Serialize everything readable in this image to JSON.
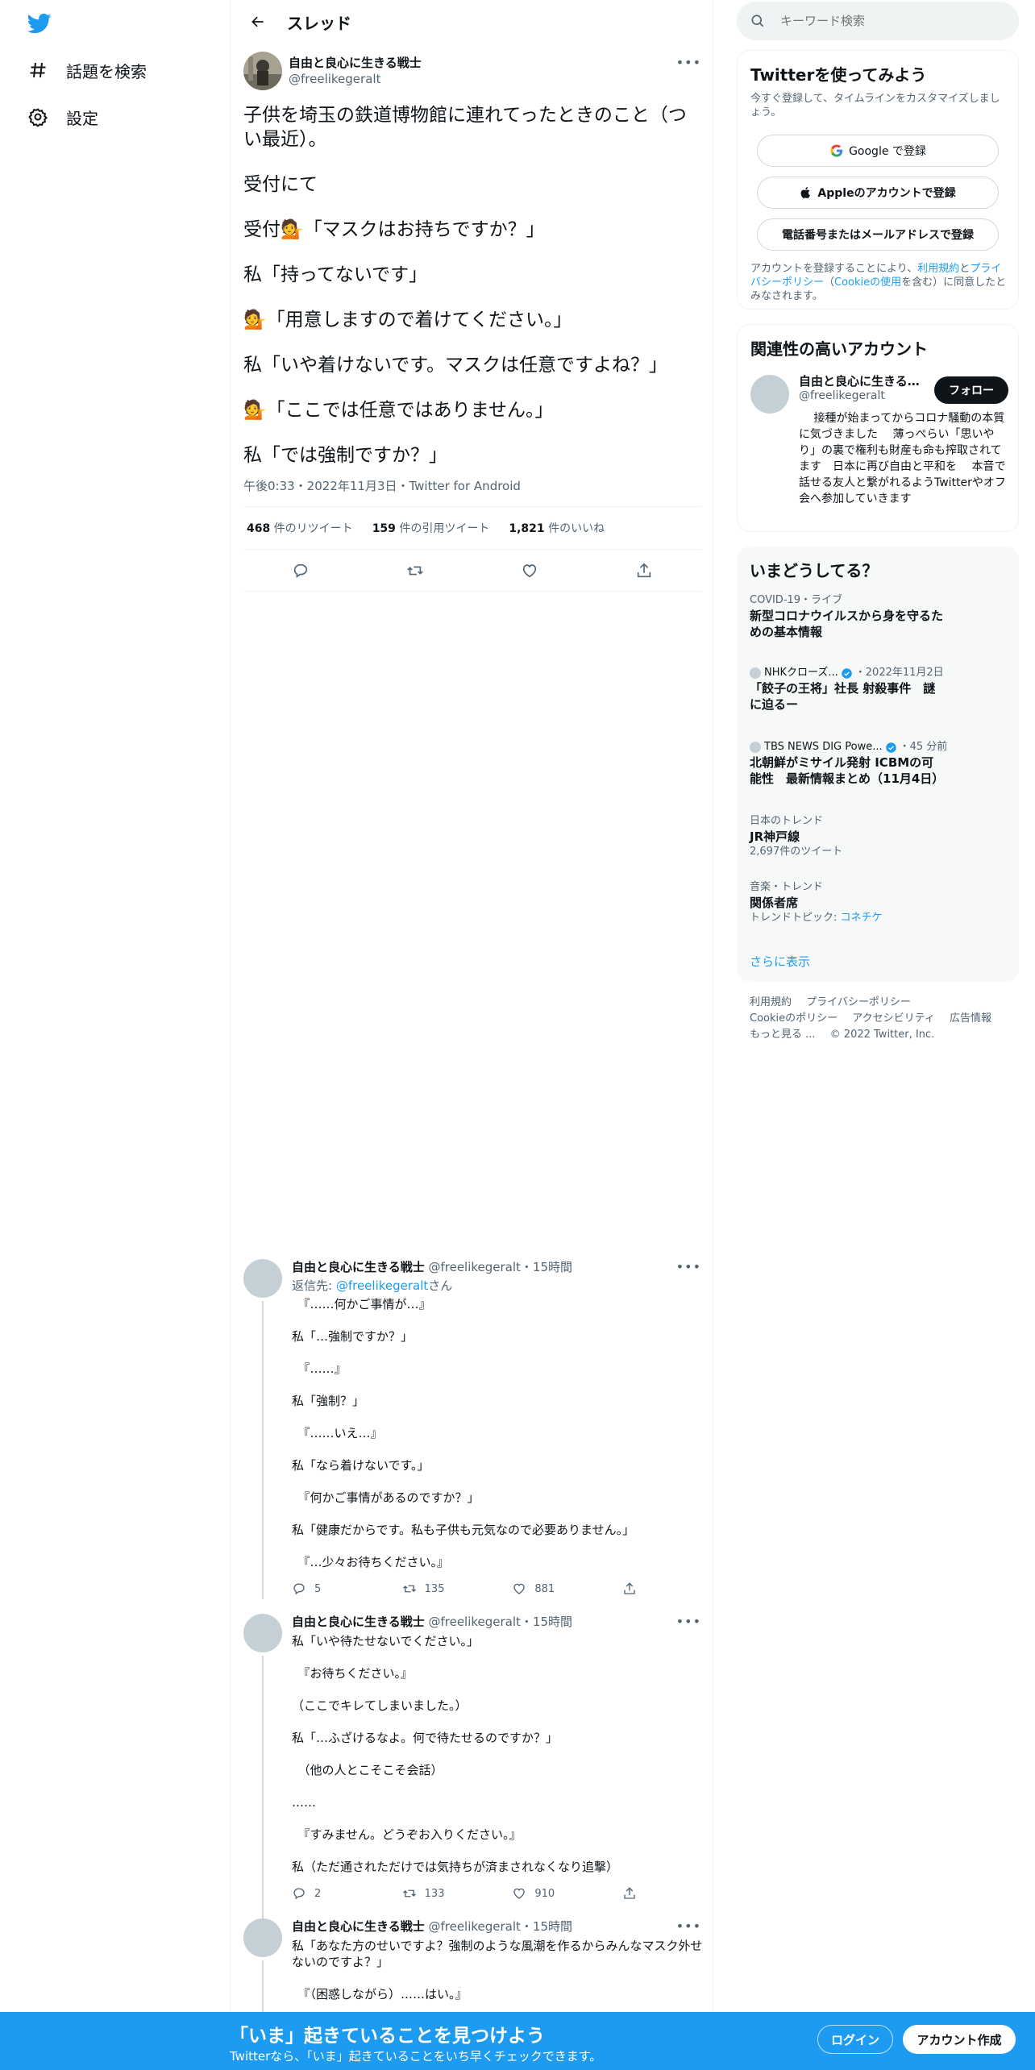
{
  "nav": {
    "explore_label": "話題を検索",
    "settings_label": "設定"
  },
  "header": {
    "title": "スレッド"
  },
  "main_tweet": {
    "author_name": "自由と良心に生きる戦士",
    "author_handle": "@freelikegeralt",
    "paragraphs": [
      "子供を埼玉の鉄道博物館に連れてったときのこと（つい最近）。",
      "受付にて",
      "受付💁「マスクはお持ちですか？」",
      "私「持ってないです」",
      "💁「用意しますので着けてください。」",
      "私「いや着けないです。マスクは任意ですよね？」",
      "💁「ここでは任意ではありません。」",
      "私「では強制ですか？」"
    ],
    "meta": "午後0:33・2022年11月3日・Twitter for Android",
    "retweets_count": "468",
    "retweets_label": " 件のリツイート",
    "quotes_count": "159",
    "quotes_label": " 件の引用ツイート",
    "likes_count": "1,821",
    "likes_label": " 件のいいね"
  },
  "replies": [
    {
      "name": "自由と良心に生きる戦士",
      "handle_time": " @freelikegeralt・15時間",
      "reply_to_prefix": "返信先: ",
      "reply_to_handle": "@freelikegeralt",
      "reply_to_suffix": "さん",
      "lines": [
        "　『……何かご事情が…』",
        "私「…強制ですか？」",
        "　『……』",
        "私「強制？」",
        "　『……いえ…』",
        "私「なら着けないです。」",
        "　『何かご事情があるのですか？」",
        "私「健康だからです。私も子供も元気なので必要ありません。」",
        "　『…少々お待ちください。』"
      ],
      "replies": "5",
      "retweets": "135",
      "likes": "881"
    },
    {
      "name": "自由と良心に生きる戦士",
      "handle_time": " @freelikegeralt・15時間",
      "lines": [
        "私「いや待たせないでください。」",
        "　『お待ちください。』",
        "（ここでキレてしまいました。）",
        "私「…ふざけるなよ。何で待たせるのですか？」",
        "　（他の人とこそこそ会話）",
        "……",
        "　『すみません。どうぞお入りください。』",
        "私（ただ通されただけでは気持ちが済まされなくなり追撃）"
      ],
      "replies": "2",
      "retweets": "133",
      "likes": "910"
    },
    {
      "name": "自由と良心に生きる戦士",
      "handle_time": " @freelikegeralt・15時間",
      "lines": [
        "私「あなた方のせいですよ？強制のような風潮を作るからみんなマスク外せないのですよ？」",
        "　『（困惑しながら）……はい。』"
      ]
    }
  ],
  "sidebar": {
    "search_placeholder": "キーワード検索",
    "signup": {
      "title": "Twitterを使ってみよう",
      "subtitle": "今すぐ登録して、タイムラインをカスタマイズしましょう。",
      "google_label": "Google で登録",
      "apple_label": "Appleのアカウントで登録",
      "phone_label": "電話番号またはメールアドレスで登録",
      "legal_1": "アカウントを登録することにより、",
      "legal_terms": "利用規約",
      "legal_2": "と",
      "legal_privacy": "プライバシーポリシー",
      "legal_3": "（",
      "legal_cookie": "Cookieの使用",
      "legal_4": "を含む）に同意したとみなされます。"
    },
    "related": {
      "title": "関連性の高いアカウント",
      "name": "自由と良心に生きる...",
      "handle": "@freelikegeralt",
      "follow_label": "フォロー",
      "bio": "　 接種が始まってからコロナ騒動の本質に気づきました　 薄っぺらい「思いやり」の裏で権利も財産も命も搾取されてます　日本に再び自由と平和を　 本音で話せる友人と繋がれるようTwitterやオフ会へ参加していきます"
    },
    "trends": {
      "title": "いまどうしてる？",
      "items": [
        {
          "meta": "COVID-19・ライブ",
          "title": "新型コロナウイルスから身を守るための基本情報"
        },
        {
          "source": "NHKクローズ...",
          "meta": "・2022年11月2日",
          "title": "「餃子の王将」社長 射殺事件　謎に迫るー"
        },
        {
          "source": "TBS NEWS DIG Powe...",
          "meta": "・45 分前",
          "title": "北朝鮮がミサイル発射 ICBMの可能性　最新情報まとめ（11月4日）"
        },
        {
          "meta": "日本のトレンド",
          "title": "JR神戸線",
          "count": "2,697件のツイート"
        },
        {
          "meta": "音楽・トレンド",
          "title": "関係者席",
          "count_prefix": "トレンドトピック: ",
          "count_link": "コネチケ"
        }
      ],
      "show_more": "さらに表示"
    },
    "footer": {
      "terms": "利用規約",
      "privacy": "プライバシーポリシー",
      "cookie": "Cookieのポリシー",
      "accessibility": "アクセシビリティ",
      "ads": "広告情報",
      "more": "もっと見る ...",
      "copyright": "© 2022 Twitter, Inc."
    }
  },
  "bottom_bar": {
    "title": "「いま」起きていることを見つけよう",
    "subtitle": "Twitterなら、「いま」起きていることをいち早くチェックできます。",
    "login_label": "ログイン",
    "signup_label": "アカウント作成"
  },
  "colors": {
    "accent": "#1d9bf0",
    "text": "#0f1419",
    "muted": "#536471"
  }
}
